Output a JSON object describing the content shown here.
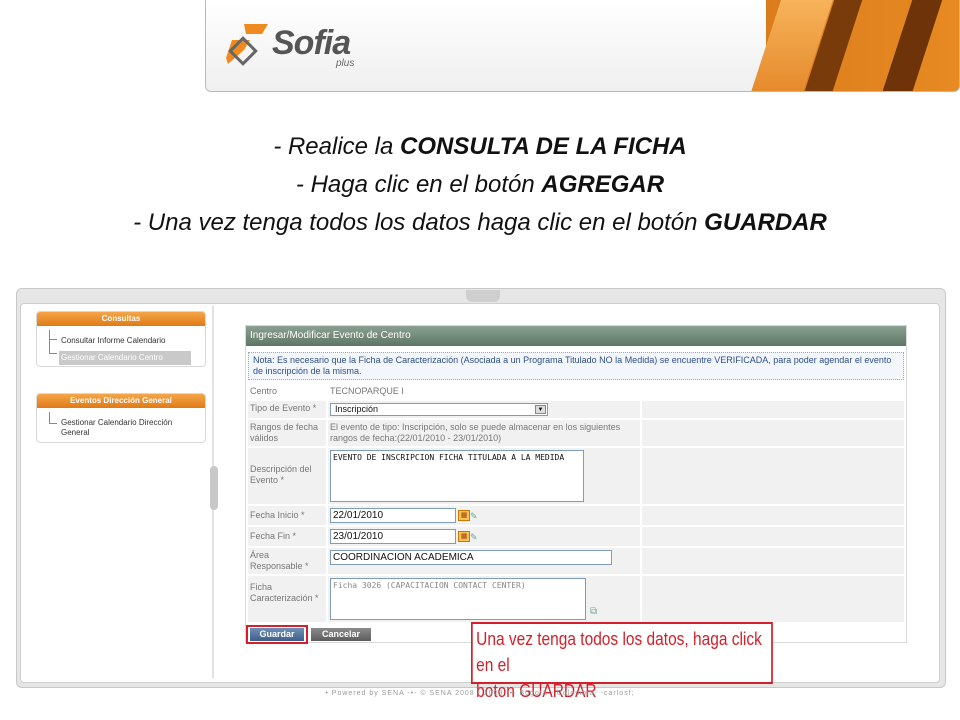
{
  "banner": {
    "logo_text": "Sofia",
    "logo_sub": "plus"
  },
  "instructions": [
    {
      "prefix": "- Realice la ",
      "bold": "CONSULTA DE LA FICHA"
    },
    {
      "prefix": "- Haga clic en el botón ",
      "bold": "AGREGAR"
    },
    {
      "prefix": "- Una vez tenga todos los datos haga clic en el botón ",
      "bold": "GUARDAR"
    }
  ],
  "menus": {
    "consultas": {
      "title": "Consultas",
      "items": [
        "Consultar Informe Calendario",
        "Gestionar Calendario Centro"
      ]
    },
    "eventos": {
      "title": "Eventos Dirección General",
      "items": [
        "Gestionar Calendario Dirección General"
      ]
    }
  },
  "form": {
    "title": "Ingresar/Modificar Evento de Centro",
    "note": "Nota: Es necesario que la Ficha de Caracterización (Asociada a un Programa Titulado NO la Medida) se encuentre VERIFICADA, para poder agendar el evento de inscripción de la misma.",
    "centro_label": "Centro",
    "centro_value": "TECNOPARQUE I",
    "tipo_label": "Tipo de Evento *",
    "tipo_value": "Inscripción",
    "rangos_label": "Rangos de fecha válidos",
    "rangos_value": "El evento de tipo: Inscripción, solo se puede almacenar en los siguientes rangos de fecha:(22/01/2010 - 23/01/2010)",
    "descripcion_label": "Descripción del Evento *",
    "descripcion_value": "EVENTO DE INSCRIPCION FICHA TITULADA A LA MEDIDA",
    "fecha_inicio_label": "Fecha Inicio *",
    "fecha_inicio_value": "22/01/2010",
    "fecha_fin_label": "Fecha Fin *",
    "fecha_fin_value": "23/01/2010",
    "area_label": "Área Responsable *",
    "area_value": "COORDINACION ACADEMICA",
    "ficha_label": "Ficha Caracterización *",
    "ficha_value": "Ficha 3026 (CAPACITACION CONTACT CENTER)"
  },
  "buttons": {
    "guardar": "Guardar",
    "cancelar": "Cancelar"
  },
  "callout": {
    "line1": "Una vez tenga todos los datos, haga click en el",
    "line2": "boton GUARDAR"
  },
  "footer": "• Powered by SENA -•- © SENA 2008 - 2009 -•- Bogotá - Colombia- -carlosf;"
}
